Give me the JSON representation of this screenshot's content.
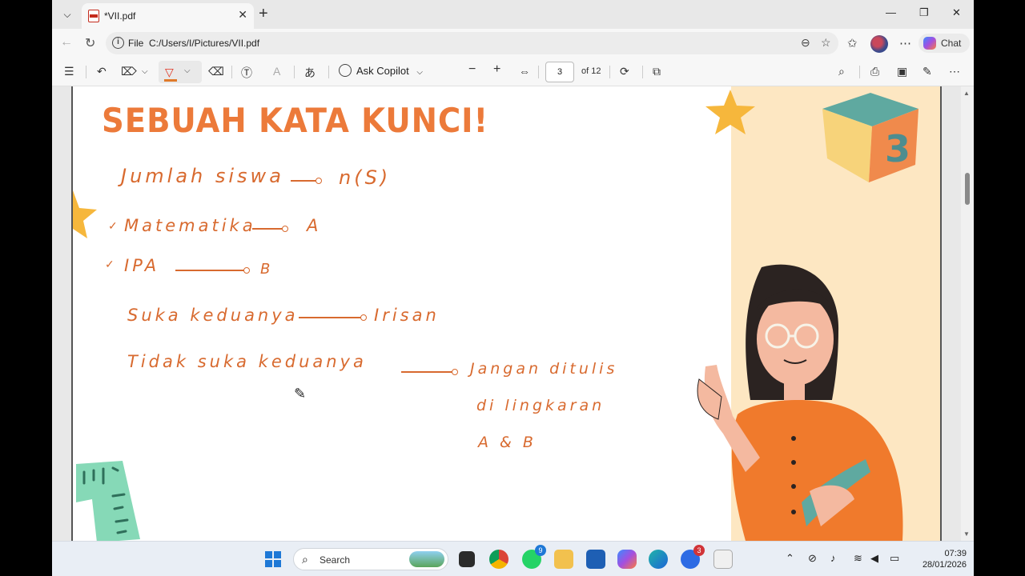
{
  "browser": {
    "tab_title": "*VII.pdf",
    "tab_close": "✕",
    "new_tab": "+",
    "minimize": "—",
    "restore": "❐",
    "close": "✕",
    "address_label": "File",
    "address_url": "C:/Users/I/Pictures/VII.pdf",
    "chat_label": "Chat"
  },
  "pdf_toolbar": {
    "ask_copilot": "Ask Copilot",
    "page_number": "3",
    "page_of": "of 12"
  },
  "slide": {
    "title": "SEBUAH KATA KUNCI!",
    "notes": [
      {
        "text": "Jumlah siswa",
        "target": "n(S)"
      },
      {
        "text": "Matematika",
        "target": "A"
      },
      {
        "text": "IPA",
        "target": "B"
      },
      {
        "text": "Suka keduanya",
        "target": "Irisan"
      },
      {
        "text": "Tidak suka keduanya",
        "target_lines": [
          "Jangan ditulis",
          "di lingkaran",
          "A & B"
        ]
      }
    ],
    "accent_color": "#ec7a3a",
    "ink_color": "#d86a2f"
  },
  "taskbar": {
    "search_placeholder": "Search",
    "whatsapp_badge": "9",
    "zoom_badge": "3",
    "time": "07:39",
    "date": "28/01/2026"
  }
}
